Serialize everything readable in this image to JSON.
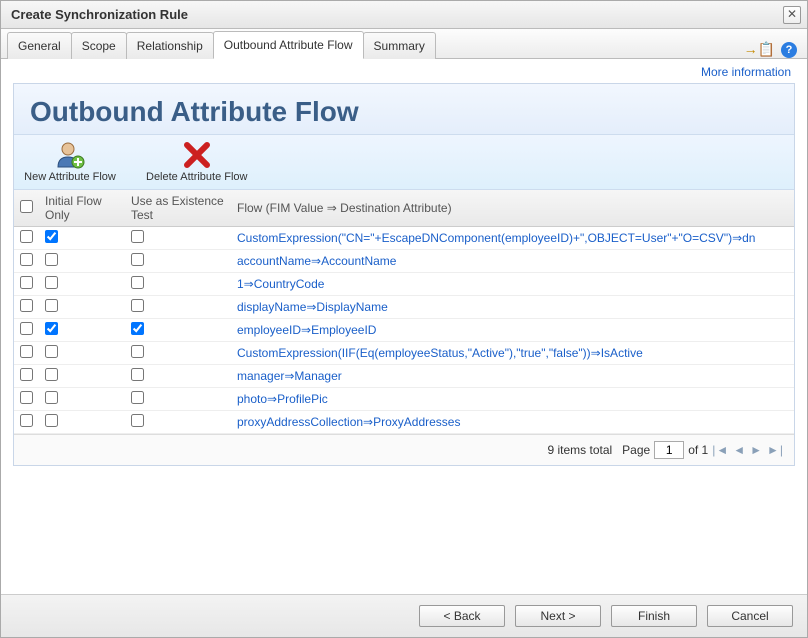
{
  "window": {
    "title": "Create Synchronization Rule"
  },
  "tabs": {
    "t0": "General",
    "t1": "Scope",
    "t2": "Relationship",
    "t3": "Outbound Attribute Flow",
    "t4": "Summary"
  },
  "links": {
    "more_info": "More information"
  },
  "panel": {
    "heading": "Outbound Attribute Flow"
  },
  "toolbar": {
    "new_flow": "New Attribute Flow",
    "delete_flow": "Delete Attribute Flow"
  },
  "columns": {
    "initial": "Initial Flow Only",
    "existence": "Use as Existence Test",
    "flow": "Flow (FIM Value ⇒ Destination Attribute)"
  },
  "rows": [
    {
      "sel": false,
      "initial": true,
      "existence": false,
      "flow": "CustomExpression(\"CN=\"+EscapeDNComponent(employeeID)+\",OBJECT=User\"+\"O=CSV\")⇒dn"
    },
    {
      "sel": false,
      "initial": false,
      "existence": false,
      "flow": "accountName⇒AccountName"
    },
    {
      "sel": false,
      "initial": false,
      "existence": false,
      "flow": "1⇒CountryCode"
    },
    {
      "sel": false,
      "initial": false,
      "existence": false,
      "flow": "displayName⇒DisplayName"
    },
    {
      "sel": false,
      "initial": true,
      "existence": true,
      "flow": "employeeID⇒EmployeeID"
    },
    {
      "sel": false,
      "initial": false,
      "existence": false,
      "flow": "CustomExpression(IIF(Eq(employeeStatus,\"Active\"),\"true\",\"false\"))⇒IsActive"
    },
    {
      "sel": false,
      "initial": false,
      "existence": false,
      "flow": "manager⇒Manager"
    },
    {
      "sel": false,
      "initial": false,
      "existence": false,
      "flow": "photo⇒ProfilePic"
    },
    {
      "sel": false,
      "initial": false,
      "existence": false,
      "flow": "proxyAddressCollection⇒ProxyAddresses"
    }
  ],
  "pager": {
    "total_text": "9 items total",
    "page_label": "Page",
    "page_value": "1",
    "of_text": "of 1"
  },
  "footer": {
    "back": "< Back",
    "next": "Next >",
    "finish": "Finish",
    "cancel": "Cancel"
  }
}
